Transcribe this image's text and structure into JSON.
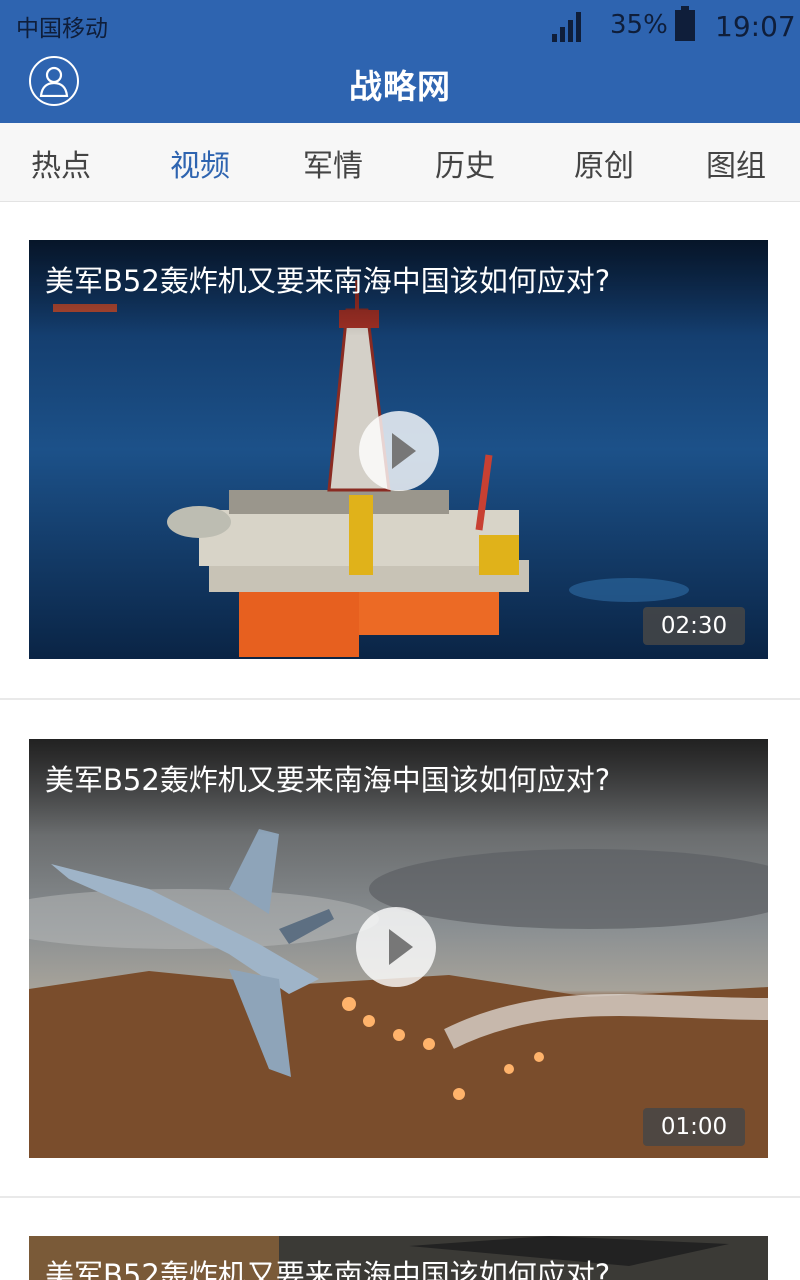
{
  "status_bar": {
    "carrier": "中国移动",
    "battery_percent": "35%",
    "time": "19:07",
    "signal_icon": "signal-bars-icon",
    "battery_icon": "battery-icon"
  },
  "header": {
    "logo_text": "战略网",
    "user_icon": "user-avatar-icon",
    "background_color": "#2e64b0"
  },
  "tabs": [
    {
      "label": "热点",
      "active": false
    },
    {
      "label": "视频",
      "active": true
    },
    {
      "label": "军情",
      "active": false
    },
    {
      "label": "历史",
      "active": false
    },
    {
      "label": "原创",
      "active": false
    },
    {
      "label": "图组",
      "active": false
    }
  ],
  "videos": [
    {
      "title": "美军B52轰炸机又要来南海中国该如何应对?",
      "duration": "02:30"
    },
    {
      "title": "美军B52轰炸机又要来南海中国该如何应对?",
      "duration": "01:00"
    },
    {
      "title": "美军B52轰炸机又要来南海中国该如何应对?",
      "duration": ""
    }
  ],
  "colors": {
    "accent": "#2e64b0",
    "tab_text": "#444444"
  }
}
